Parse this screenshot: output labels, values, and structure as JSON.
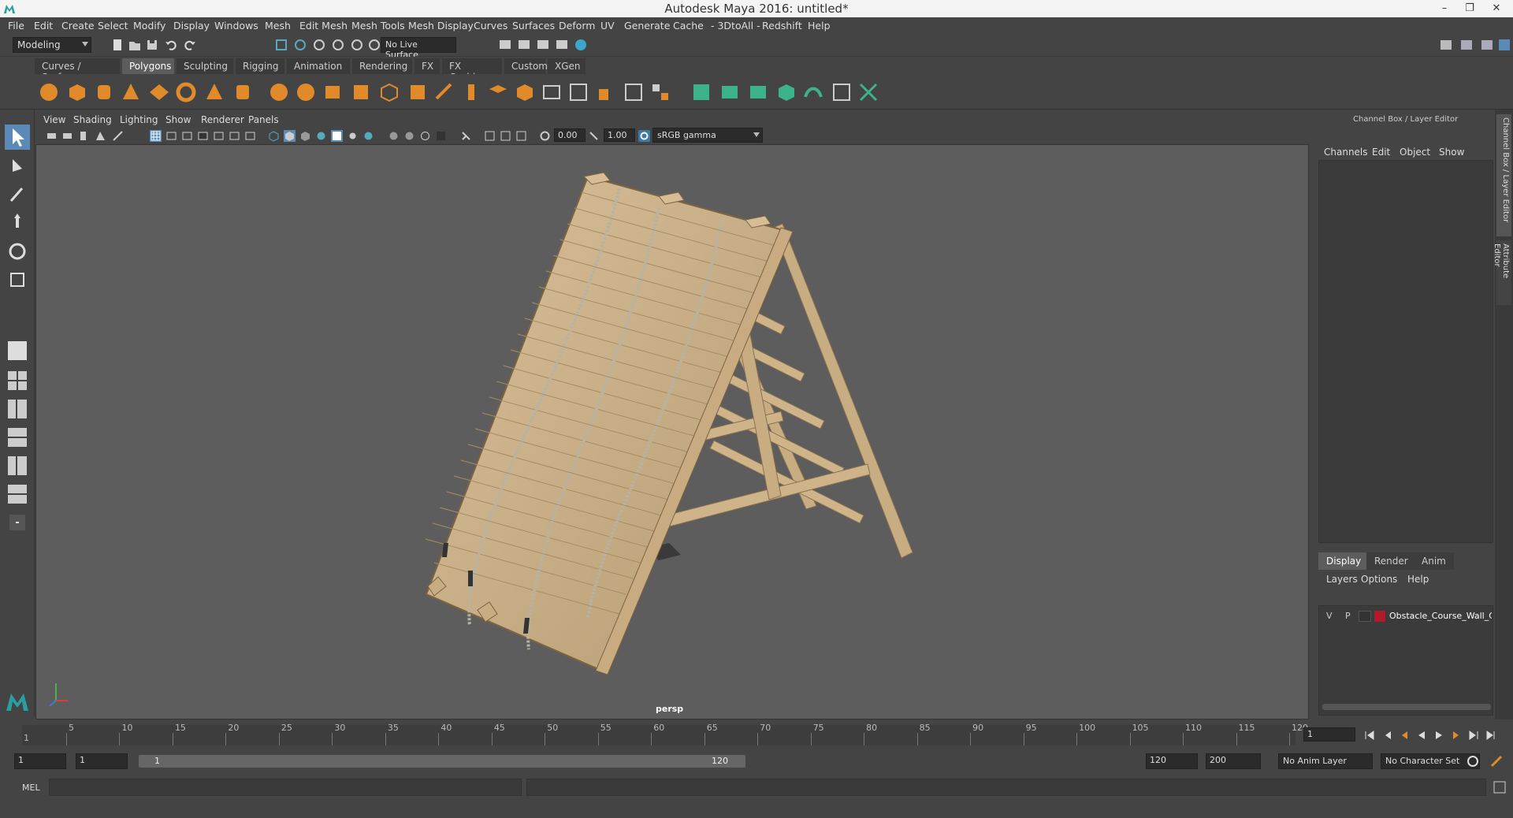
{
  "window": {
    "title": "Autodesk Maya 2016: untitled*",
    "min": "–",
    "restore": "❐",
    "close": "✕"
  },
  "menubar": [
    "File",
    "Edit",
    "Create",
    "Select",
    "Modify",
    "Display",
    "Windows",
    "Mesh",
    "Edit Mesh",
    "Mesh Tools",
    "Mesh Display",
    "Curves",
    "Surfaces",
    "Deform",
    "UV",
    "Generate",
    "Cache",
    "- 3DtoAll -",
    "Redshift",
    "Help"
  ],
  "status": {
    "mode": "Modeling",
    "live_surface": "No Live Surface"
  },
  "shelf_tabs": [
    "Curves / Surfaces",
    "Polygons",
    "Sculpting",
    "Rigging",
    "Animation",
    "Rendering",
    "FX",
    "FX Caching",
    "Custom",
    "XGen"
  ],
  "shelf_active": "Polygons",
  "panel_menu": [
    "View",
    "Shading",
    "Lighting",
    "Show",
    "Renderer",
    "Panels"
  ],
  "panel_toolbar": {
    "exposure": "0.00",
    "gamma": "1.00",
    "color_space": "sRGB gamma"
  },
  "viewport": {
    "camera": "persp"
  },
  "channel_box": {
    "title": "Channel Box / Layer Editor",
    "menu": [
      "Channels",
      "Edit",
      "Object",
      "Show"
    ]
  },
  "layer_editor": {
    "tabs": [
      "Display",
      "Render",
      "Anim"
    ],
    "active": "Display",
    "menu": [
      "Layers",
      "Options",
      "Help"
    ],
    "layer": {
      "v": "V",
      "p": "P",
      "name": "Obstacle_Course_Wall_C",
      "color": "#b01a2a"
    }
  },
  "side_tabs": [
    "Channel Box / Layer Editor",
    "Attribute Editor"
  ],
  "timeline": {
    "ticks": [
      5,
      10,
      15,
      20,
      25,
      30,
      35,
      40,
      45,
      50,
      55,
      60,
      65,
      70,
      75,
      80,
      85,
      90,
      95,
      100,
      105,
      110,
      115,
      120
    ],
    "current_start": "1",
    "current_frame": "1"
  },
  "range": {
    "start": "1",
    "start2": "1",
    "slider_start": "1",
    "slider_end": "120",
    "end": "120",
    "end2": "200",
    "anim_layer": "No Anim Layer",
    "char_set": "No Character Set"
  },
  "cmdline": {
    "label": "MEL"
  }
}
